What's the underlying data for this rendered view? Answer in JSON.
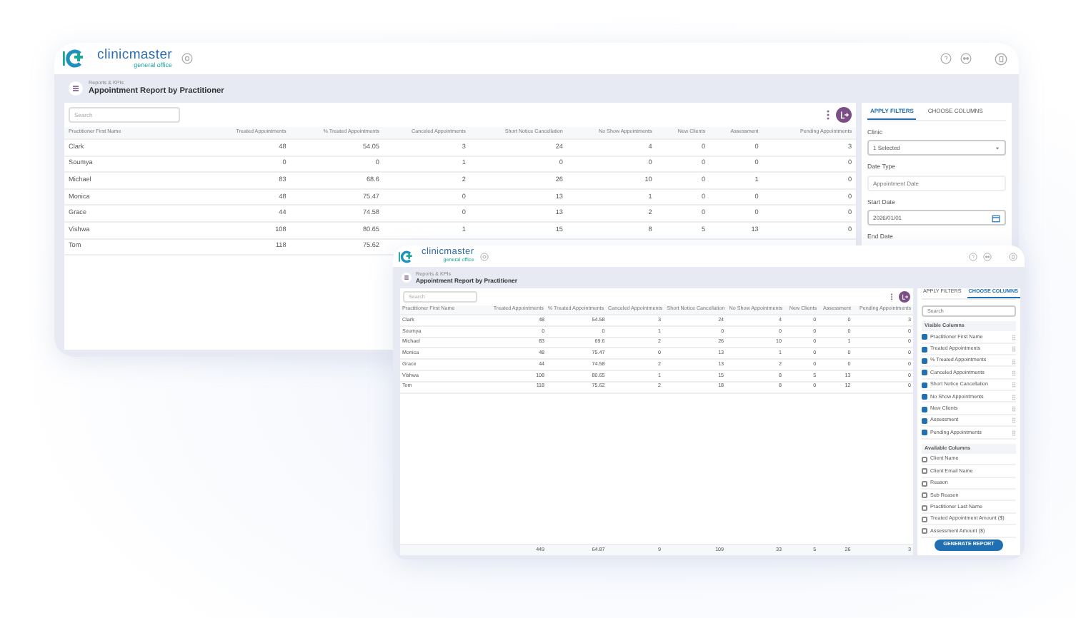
{
  "windows": [
    {
      "logo": {
        "name": "clinicmaster",
        "tagline": "general office"
      },
      "breadcrumb": "Reports & KPIs",
      "title": "Appointment Report by Practitioner",
      "search": {
        "placeholder": "Search"
      },
      "table": {
        "columns": [
          "Practitioner First Name",
          "Treated Appointments",
          "% Treated Appointments",
          "Canceled Appointments",
          "Short Notice Cancellation",
          "No Show Appointments",
          "New Clients",
          "Assessment",
          "Pending Appointments"
        ],
        "rows": [
          [
            "Clark",
            "48",
            "54.05",
            "3",
            "24",
            "4",
            "0",
            "0",
            "3"
          ],
          [
            "Soumya",
            "0",
            "0",
            "1",
            "0",
            "0",
            "0",
            "0",
            "0"
          ],
          [
            "Michael",
            "83",
            "68.6",
            "2",
            "26",
            "10",
            "0",
            "1",
            "0"
          ],
          [
            "Monica",
            "48",
            "75.47",
            "0",
            "13",
            "1",
            "0",
            "0",
            "0"
          ],
          [
            "Grace",
            "44",
            "74.58",
            "0",
            "13",
            "2",
            "0",
            "0",
            "0"
          ],
          [
            "Vishwa",
            "108",
            "80.65",
            "1",
            "15",
            "8",
            "5",
            "13",
            "0"
          ],
          [
            "Tom",
            "118",
            "75.62"
          ]
        ]
      },
      "panel": {
        "tabs": [
          {
            "label": "APPLY FILTERS",
            "selected": true
          },
          {
            "label": "CHOOSE COLUMNS",
            "selected": false
          }
        ],
        "items": [
          {
            "kind": "label",
            "text": "Clinic"
          },
          {
            "kind": "select",
            "value": "1 Selected"
          },
          {
            "kind": "label",
            "text": "Date Type"
          },
          {
            "kind": "input",
            "placeholder": "Appointment Date"
          },
          {
            "kind": "label",
            "text": "Start Date"
          },
          {
            "kind": "date",
            "value": "2026/01/01"
          },
          {
            "kind": "label",
            "text": "End Date"
          }
        ]
      }
    },
    {
      "logo": {
        "name": "clinicmaster",
        "tagline": "general office"
      },
      "breadcrumb": "Reports & KPIs",
      "title": "Appointment Report by Practitioner",
      "search": {
        "placeholder": "Search"
      },
      "table": {
        "columns": [
          "Practitioner First Name",
          "Treated Appointments",
          "% Treated Appointments",
          "Canceled Appointments",
          "Short Notice Cancellation",
          "No Show Appointments",
          "New Clients",
          "Assessment",
          "Pending Appointments"
        ],
        "rows": [
          [
            "Clark",
            "48",
            "54.58",
            "3",
            "24",
            "4",
            "0",
            "0",
            "3"
          ],
          [
            "Soumya",
            "0",
            "0",
            "1",
            "0",
            "0",
            "0",
            "0",
            "0"
          ],
          [
            "Michael",
            "83",
            "69.6",
            "2",
            "26",
            "10",
            "0",
            "1",
            "0"
          ],
          [
            "Monica",
            "48",
            "75.47",
            "0",
            "13",
            "1",
            "0",
            "0",
            "0"
          ],
          [
            "Grace",
            "44",
            "74.58",
            "2",
            "13",
            "2",
            "0",
            "0",
            "0"
          ],
          [
            "Vishwa",
            "108",
            "80.65",
            "1",
            "15",
            "8",
            "5",
            "13",
            "0"
          ],
          [
            "Tom",
            "118",
            "75.62",
            "2",
            "18",
            "8",
            "0",
            "12",
            "0"
          ]
        ],
        "totals": [
          "449",
          "64.87",
          "9",
          "109",
          "33",
          "5",
          "26",
          "3"
        ]
      },
      "panel": {
        "tabs": [
          {
            "label": "APPLY FILTERS",
            "selected": false
          },
          {
            "label": "CHOOSE COLUMNS",
            "selected": true
          }
        ],
        "items": [
          {
            "kind": "search",
            "placeholder": "Search"
          },
          {
            "kind": "heading",
            "text": "Visible Columns"
          },
          {
            "kind": "checkbox",
            "label": "Practitioner First Name",
            "checked": true
          },
          {
            "kind": "checkbox",
            "label": "Treated Appointments",
            "checked": true
          },
          {
            "kind": "checkbox",
            "label": "% Treated Appointments",
            "checked": true
          },
          {
            "kind": "checkbox",
            "label": "Canceled Appointments",
            "checked": true
          },
          {
            "kind": "checkbox",
            "label": "Short Notice Cancellation",
            "checked": true
          },
          {
            "kind": "checkbox",
            "label": "No Show Appointments",
            "checked": true
          },
          {
            "kind": "checkbox",
            "label": "New Clients",
            "checked": true
          },
          {
            "kind": "checkbox",
            "label": "Assessment",
            "checked": true
          },
          {
            "kind": "checkbox",
            "label": "Pending Appointments",
            "checked": true
          },
          {
            "kind": "heading",
            "text": "Available Columns"
          },
          {
            "kind": "checkbox",
            "label": "Client Name",
            "checked": false
          },
          {
            "kind": "checkbox",
            "label": "Client Email Name",
            "checked": false
          },
          {
            "kind": "checkbox",
            "label": "Reason",
            "checked": false
          },
          {
            "kind": "checkbox",
            "label": "Sub Reason",
            "checked": false
          },
          {
            "kind": "checkbox",
            "label": "Practitioner Last Name",
            "checked": false
          },
          {
            "kind": "checkbox",
            "label": "Treated Appointment Amount ($)",
            "checked": false
          },
          {
            "kind": "checkbox",
            "label": "Assessment Amount ($)",
            "checked": false
          },
          {
            "kind": "button",
            "label": "GENERATE REPORT"
          }
        ]
      }
    }
  ]
}
